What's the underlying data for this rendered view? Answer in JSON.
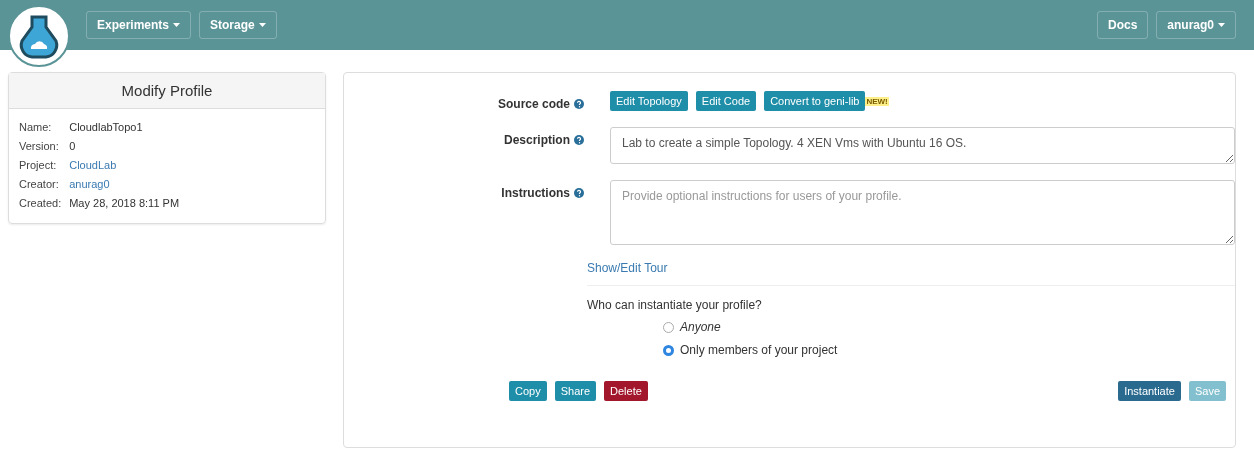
{
  "navbar": {
    "menus": [
      {
        "label": "Experiments",
        "dropdown": true
      },
      {
        "label": "Storage",
        "dropdown": true
      }
    ],
    "right": [
      {
        "label": "Docs",
        "dropdown": false
      },
      {
        "label": "anurag0",
        "dropdown": true
      }
    ]
  },
  "profile_panel": {
    "title": "Modify Profile",
    "fields": [
      {
        "label": "Name:",
        "value": "CloudlabTopo1",
        "link": false
      },
      {
        "label": "Version:",
        "value": "0",
        "link": false
      },
      {
        "label": "Project:",
        "value": "CloudLab",
        "link": true
      },
      {
        "label": "Creator:",
        "value": "anurag0",
        "link": true
      },
      {
        "label": "Created:",
        "value": "May 28, 2018 8:11 PM",
        "link": false
      }
    ]
  },
  "form": {
    "source_code": {
      "label": "Source code",
      "buttons": [
        "Edit Topology",
        "Edit Code",
        "Convert to geni-lib"
      ],
      "badge": "NEW!"
    },
    "description": {
      "label": "Description",
      "value": "Lab to create a simple Topology. 4 XEN Vms with Ubuntu 16 OS."
    },
    "instructions": {
      "label": "Instructions",
      "placeholder": "Provide optional instructions for users of your profile."
    },
    "tour_link": "Show/Edit Tour",
    "access": {
      "question": "Who can instantiate your profile?",
      "options": [
        {
          "label": "Anyone",
          "selected": false,
          "italic": true
        },
        {
          "label": "Only members of your project",
          "selected": true,
          "italic": false
        }
      ]
    },
    "left_buttons": [
      {
        "label": "Copy",
        "kind": "info",
        "disabled": false
      },
      {
        "label": "Share",
        "kind": "info",
        "disabled": false
      },
      {
        "label": "Delete",
        "kind": "danger",
        "disabled": false
      }
    ],
    "right_buttons": [
      {
        "label": "Instantiate",
        "kind": "primary",
        "disabled": false
      },
      {
        "label": "Save",
        "kind": "info",
        "disabled": true
      }
    ]
  }
}
